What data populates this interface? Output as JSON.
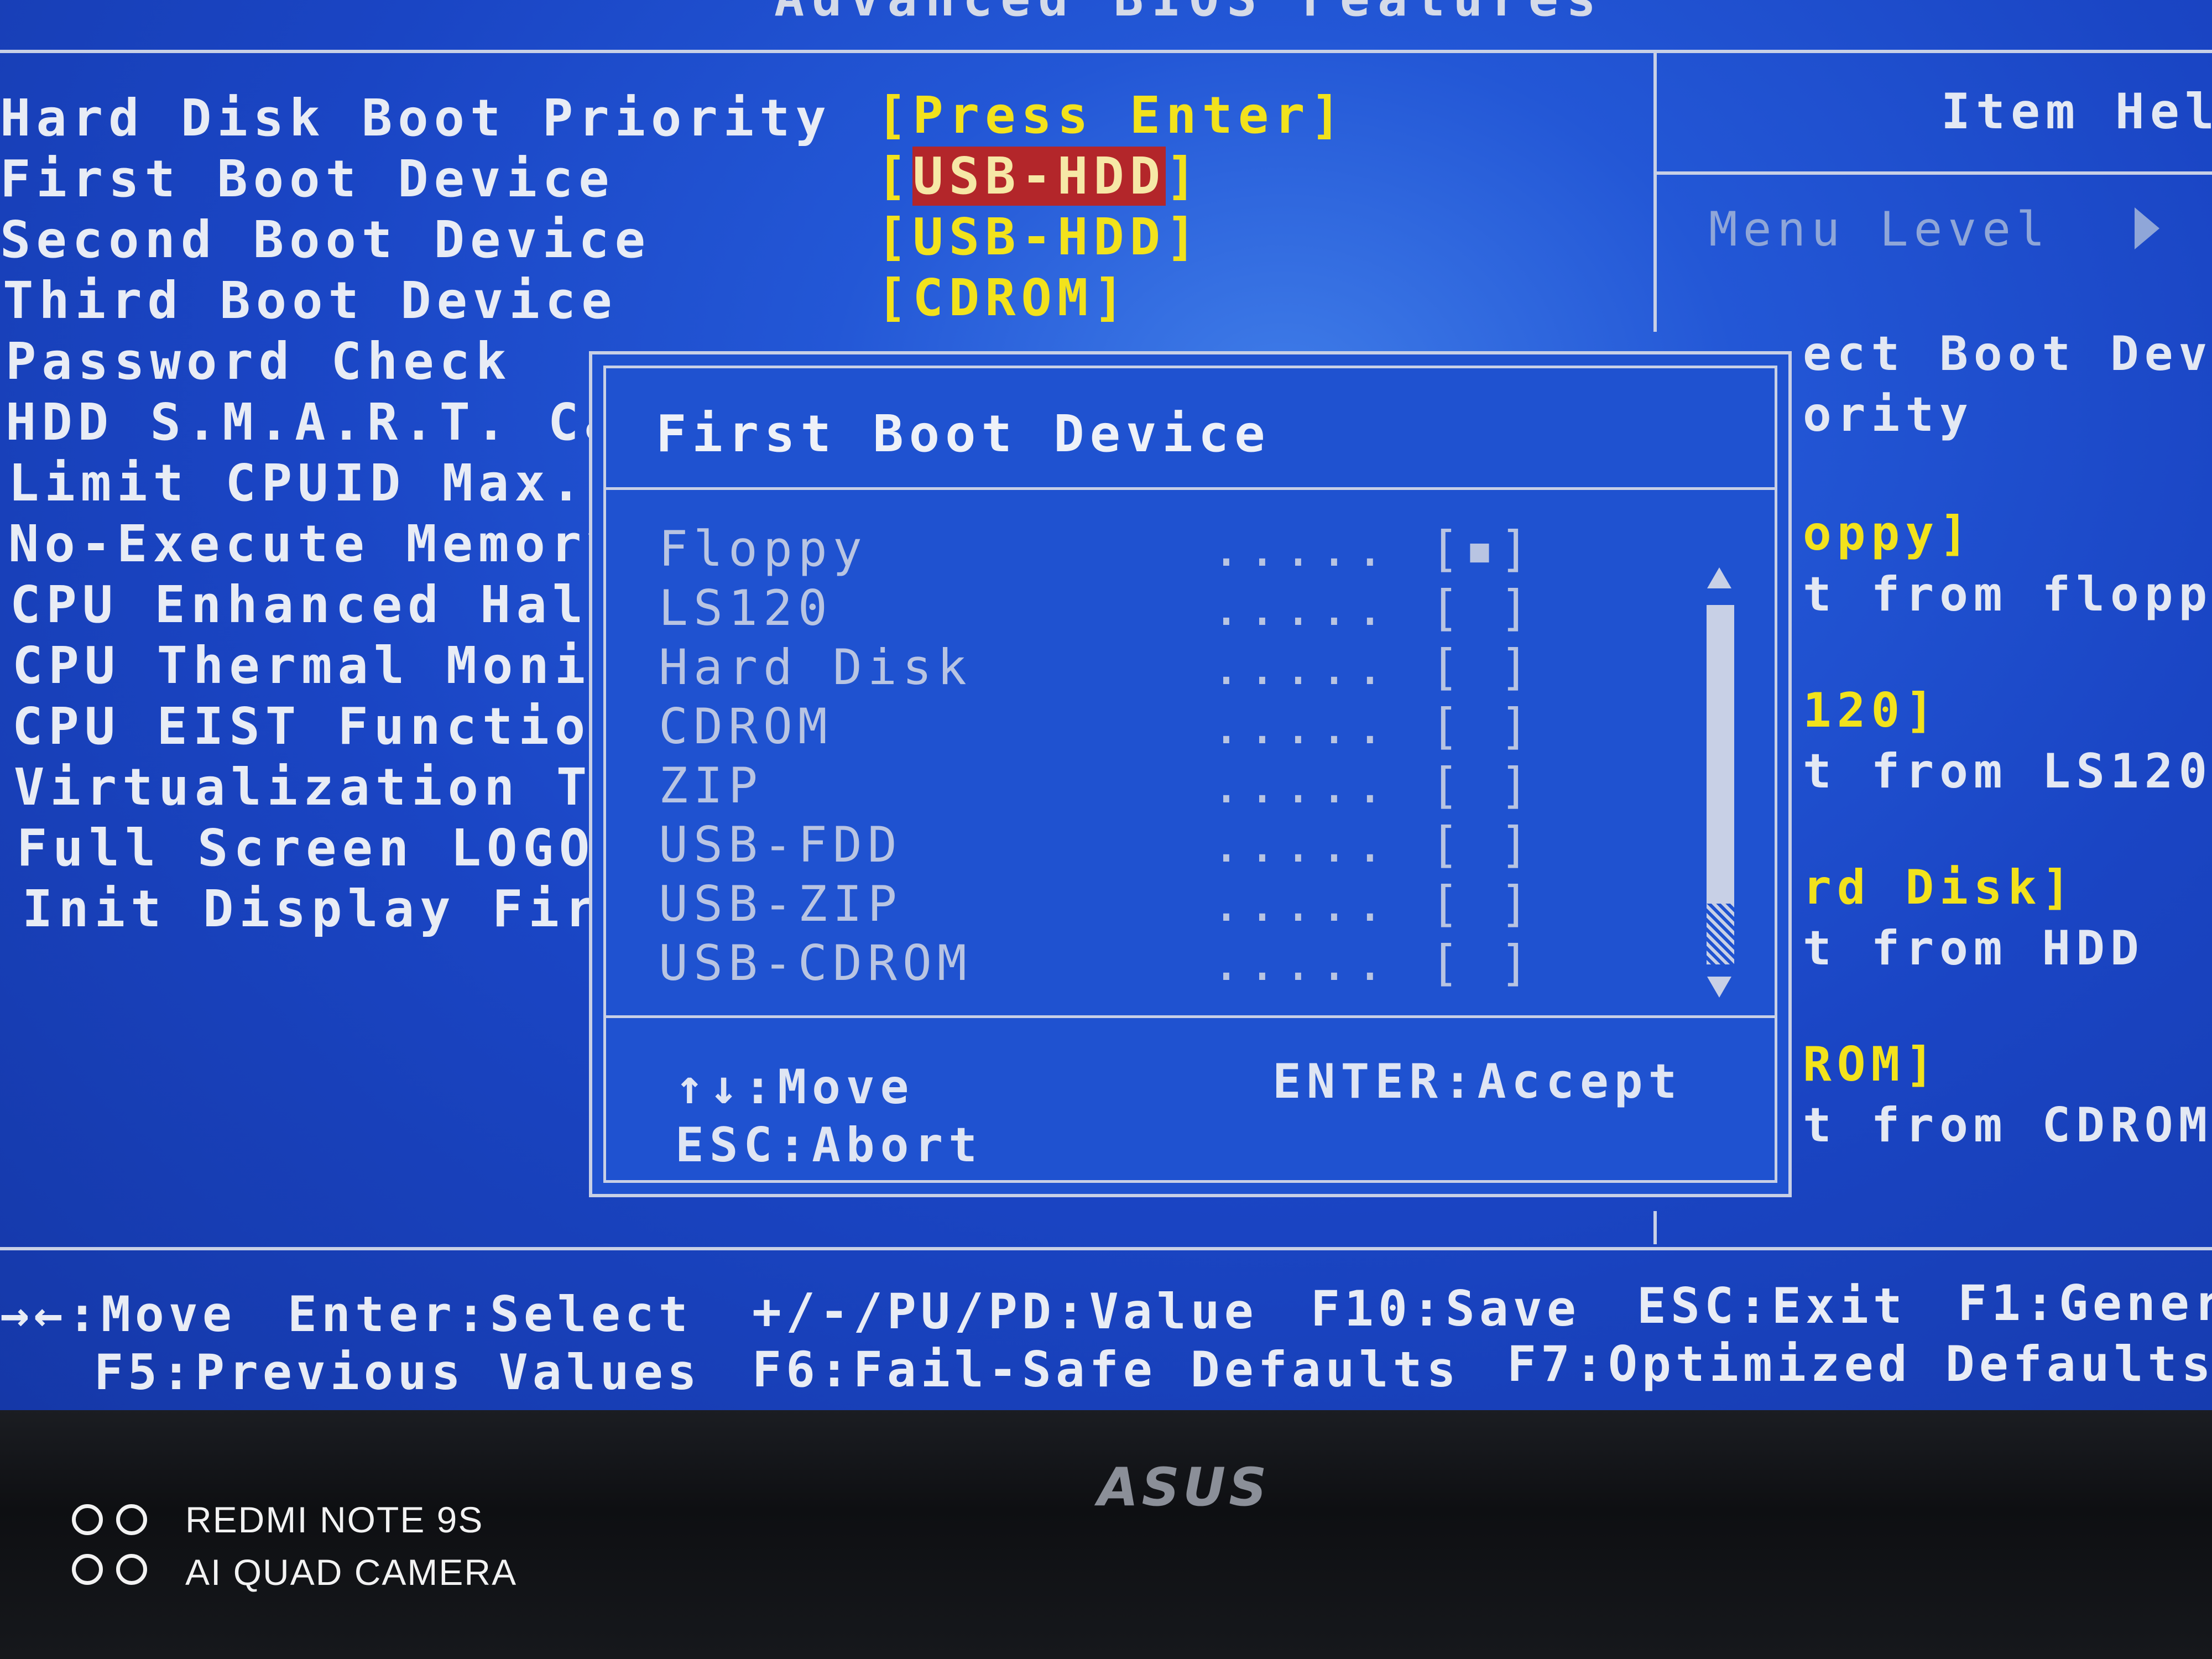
{
  "screen_title": "Advanced BIOS Features",
  "settings": [
    {
      "label": "Hard Disk Boot Priority",
      "value": "[Press Enter]"
    },
    {
      "label": "First Boot Device",
      "value": "[USB-HDD]",
      "selected": true
    },
    {
      "label": "Second Boot Device",
      "value": "[USB-HDD]"
    },
    {
      "label": "Third Boot Device",
      "value": "[CDROM]"
    },
    {
      "label": "Password Check"
    },
    {
      "label": "HDD S.M.A.R.T. Ca"
    },
    {
      "label": "Limit CPUID Max."
    },
    {
      "label": "No-Execute Memory"
    },
    {
      "label": "CPU Enhanced Halt"
    },
    {
      "label": "CPU Thermal Monit"
    },
    {
      "label": "CPU EIST Function"
    },
    {
      "label": "Virtualization Te"
    },
    {
      "label": "Full Screen LOGO"
    },
    {
      "label": "Init Display Firs"
    }
  ],
  "help_panel": {
    "title": "Item Help",
    "menu_level": "Menu Level",
    "lines": [
      {
        "text": "ect Boot Devi",
        "color": "text"
      },
      {
        "text": "ority",
        "color": "text"
      },
      {
        "text": "oppy]",
        "color": "yellow"
      },
      {
        "text": "t from floppy",
        "color": "text"
      },
      {
        "text": "120]",
        "color": "yellow"
      },
      {
        "text": "t from LS120",
        "color": "text"
      },
      {
        "text": "rd Disk]",
        "color": "yellow"
      },
      {
        "text": "t from HDD",
        "color": "text"
      },
      {
        "text": "ROM]",
        "color": "yellow"
      },
      {
        "text": "t from CDROM",
        "color": "text"
      }
    ]
  },
  "popup": {
    "title": "First Boot Device",
    "options": [
      {
        "name": "Floppy",
        "dots": ".....",
        "box": "[▪]"
      },
      {
        "name": "LS120",
        "dots": ".....",
        "box": "[ ]"
      },
      {
        "name": "Hard Disk",
        "dots": ".....",
        "box": "[ ]"
      },
      {
        "name": "CDROM",
        "dots": ".....",
        "box": "[ ]"
      },
      {
        "name": "ZIP",
        "dots": ".....",
        "box": "[ ]"
      },
      {
        "name": "USB-FDD",
        "dots": ".....",
        "box": "[ ]"
      },
      {
        "name": "USB-ZIP",
        "dots": ".....",
        "box": "[ ]"
      },
      {
        "name": "USB-CDROM",
        "dots": ".....",
        "box": "[ ]"
      }
    ],
    "hint_move": "↑↓:Move",
    "hint_accept": "ENTER:Accept",
    "hint_abort": "ESC:Abort"
  },
  "footer": {
    "move": "→←:Move",
    "select": "Enter:Select",
    "value": "+/-/PU/PD:Value",
    "save": "F10:Save",
    "exit": "ESC:Exit",
    "general": "F1:Gener",
    "previous": "F5:Previous Values",
    "failsafe": "F6:Fail-Safe Defaults",
    "optimized": "F7:Optimized Defaults"
  },
  "monitor_brand": "ASUS",
  "camera_watermark": {
    "line1": "REDMI NOTE 9S",
    "line2": "AI QUAD CAMERA"
  }
}
